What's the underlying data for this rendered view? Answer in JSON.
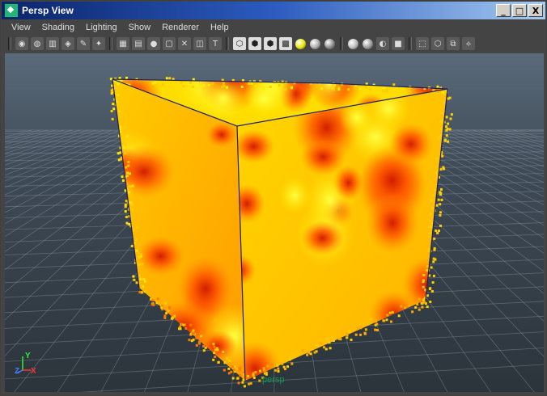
{
  "window": {
    "title": "Persp View",
    "minimize": "_",
    "maximize": "□",
    "close": "X"
  },
  "menu": [
    "View",
    "Shading",
    "Lighting",
    "Show",
    "Renderer",
    "Help"
  ],
  "toolbar_groups": [
    [
      "camera-attributes-icon",
      "camera-bookmark-icon",
      "image-plane-icon",
      "2d-pan-zoom-icon",
      "grease-pencil-icon",
      "isolate-select-icon"
    ],
    [
      "grid-toggle-icon",
      "film-gate-icon",
      "resolution-gate-icon",
      "gate-mask-icon",
      "field-chart-icon",
      "safe-action-icon",
      "safe-title-icon"
    ],
    [
      "wireframe-icon",
      "smooth-shade-icon",
      "flat-shade-icon",
      "textured-icon",
      "use-lights-icon",
      "shadows-icon",
      "screen-space-ao-icon"
    ],
    [
      "motion-blur-icon",
      "multisample-icon",
      "depth-of-field-icon",
      "hardware-fog-icon"
    ],
    [
      "xray-icon",
      "xray-active-icon",
      "xray-joints-icon",
      "backface-culling-icon"
    ]
  ],
  "viewport": {
    "camera_label": "persp",
    "axis_x": "X",
    "axis_y": "Y",
    "axis_z": "Z"
  },
  "colors": {
    "hot": "#cc1a00",
    "warm": "#ff6a00",
    "mid": "#ff9a00",
    "cool": "#ffe800",
    "bright": "#ffff33"
  }
}
